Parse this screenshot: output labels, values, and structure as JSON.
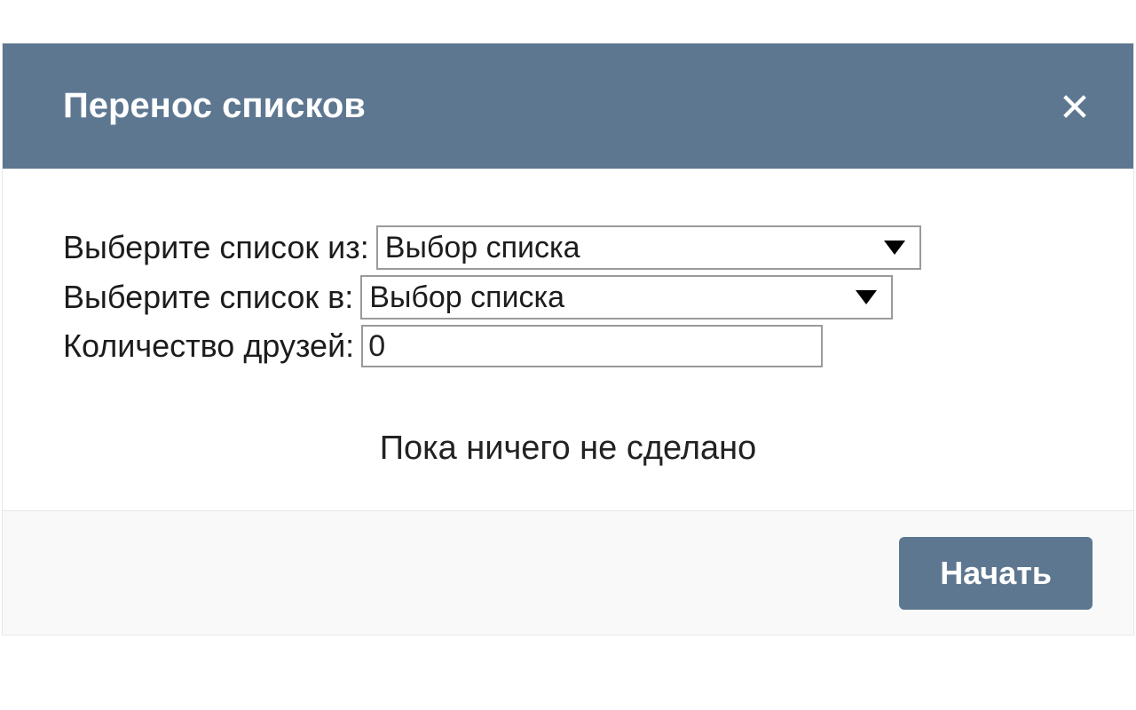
{
  "dialog": {
    "title": "Перенос списков"
  },
  "form": {
    "from_label": "Выберите список из:",
    "from_selected": "Выбор списка",
    "to_label": "Выберите список в:",
    "to_selected": "Выбор списка",
    "count_label": "Количество друзей:",
    "count_value": "0"
  },
  "status": {
    "message": "Пока ничего не сделано"
  },
  "footer": {
    "start_label": "Начать"
  }
}
